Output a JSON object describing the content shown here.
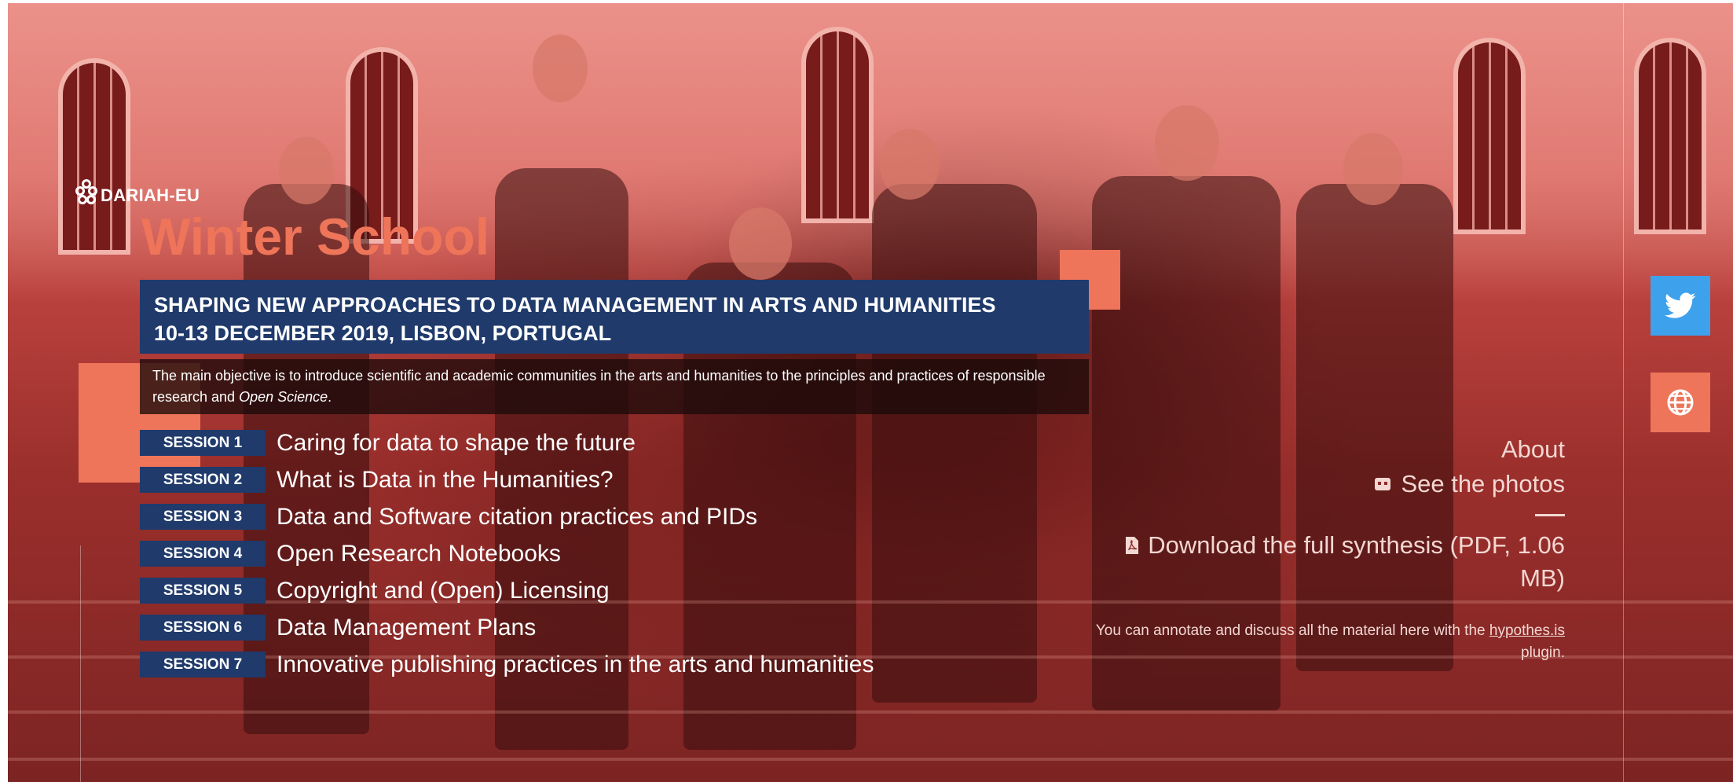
{
  "brand": {
    "logo_text": "DARIAH-EU",
    "title": "Winter School"
  },
  "header": {
    "subtitle_line1": "SHAPING NEW APPROACHES TO DATA MANAGEMENT IN ARTS AND HUMANITIES",
    "subtitle_line2": "10-13 DECEMBER 2019, LISBON, PORTUGAL",
    "description_pre": "The main objective is to introduce scientific and academic communities in the arts and humanities to the principles and practices of responsible research and ",
    "description_em": "Open Science",
    "description_post": "."
  },
  "sessions": [
    {
      "label": "SESSION 1",
      "title": "Caring for data to shape the future"
    },
    {
      "label": "SESSION 2",
      "title": "What is Data in the Humanities?"
    },
    {
      "label": "SESSION 3",
      "title": "Data and Software citation practices and PIDs"
    },
    {
      "label": "SESSION 4",
      "title": "Open Research Notebooks"
    },
    {
      "label": "SESSION 5",
      "title": "Copyright and (Open) Licensing"
    },
    {
      "label": "SESSION 6",
      "title": "Data Management Plans"
    },
    {
      "label": "SESSION 7",
      "title": "Innovative publishing practices in the arts and humanities"
    }
  ],
  "nav": {
    "about": "About",
    "photos": "See the photos",
    "download": "Download the full synthesis (PDF, 1.06 MB)",
    "note_pre": "You can annotate and discuss all the material here with the ",
    "note_link": "hypothes.is",
    "note_post": " plugin."
  },
  "icons": {
    "twitter": "twitter-icon",
    "web": "globe-icon",
    "photos": "camera-icon",
    "pdf": "pdf-file-icon"
  },
  "colors": {
    "accent": "#ee7559",
    "navy": "#1f3a6b",
    "twitter": "#3ea1ec",
    "overlay": "#c0403d"
  }
}
